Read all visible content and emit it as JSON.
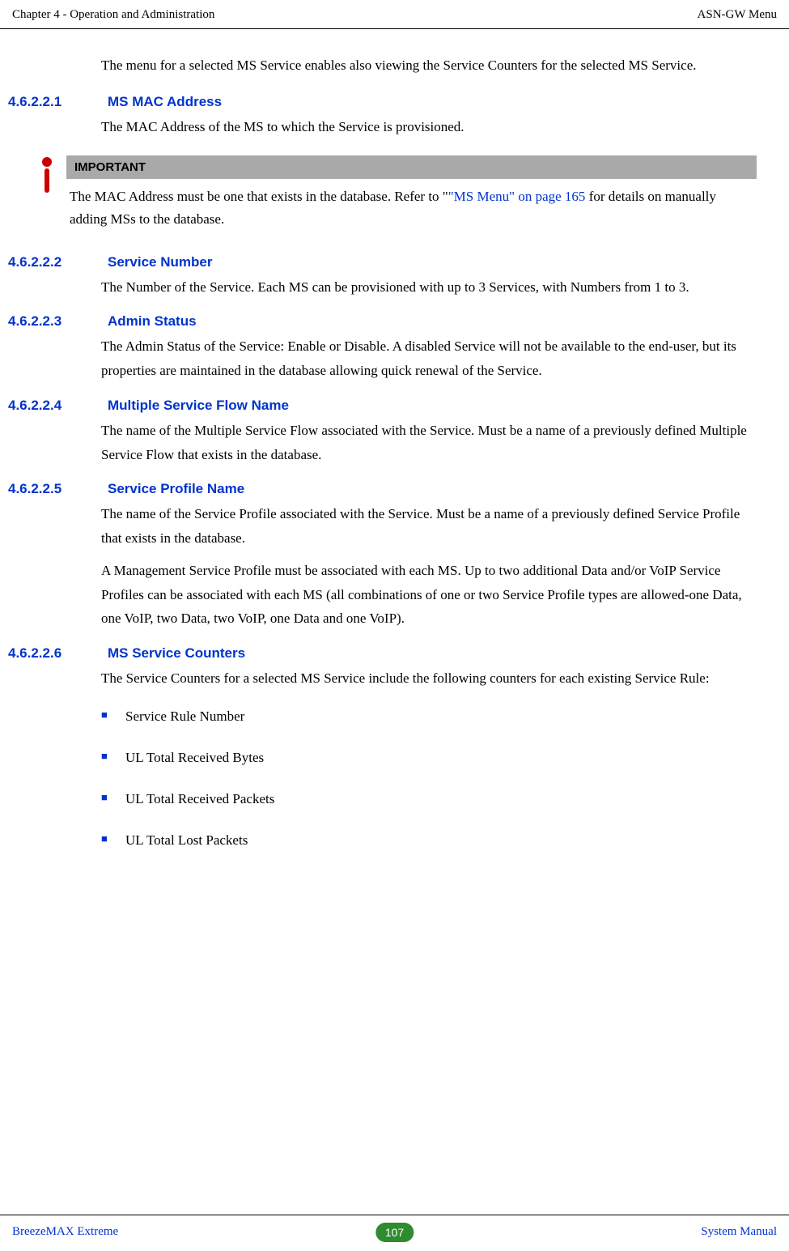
{
  "header": {
    "left": "Chapter 4 - Operation and Administration",
    "right": "ASN-GW Menu"
  },
  "intro": "The menu for a selected MS Service enables also viewing the Service Counters for the selected MS Service.",
  "sections": [
    {
      "number": "4.6.2.2.1",
      "title": "MS MAC Address",
      "body": [
        "The MAC Address of the MS to which the Service is provisioned."
      ]
    },
    {
      "number": "4.6.2.2.2",
      "title": "Service Number",
      "body": [
        "The Number of the Service. Each MS can be provisioned with up to 3 Services, with Numbers from 1 to 3."
      ]
    },
    {
      "number": "4.6.2.2.3",
      "title": "Admin Status",
      "body": [
        "The Admin Status of the Service: Enable or Disable. A disabled Service will not be available to the end-user, but its properties are maintained in the database allowing quick renewal of the Service."
      ]
    },
    {
      "number": "4.6.2.2.4",
      "title": "Multiple Service Flow Name",
      "body": [
        "The name of the Multiple Service Flow associated with the Service. Must be a name of a previously defined Multiple Service Flow that exists in the database."
      ]
    },
    {
      "number": "4.6.2.2.5",
      "title": "Service Profile Name",
      "body": [
        "The name of the Service Profile associated with the Service. Must be a name of a previously defined Service Profile that exists in the database.",
        "A Management Service Profile must be associated with each MS. Up to two additional Data and/or VoIP Service Profiles can be associated with each MS (all combinations of one or two Service Profile types are allowed-one Data, one VoIP, two Data, two VoIP, one Data and one VoIP)."
      ]
    },
    {
      "number": "4.6.2.2.6",
      "title": "MS Service Counters",
      "body": [
        "The Service Counters for a selected MS Service include the following counters for each existing Service Rule:"
      ]
    }
  ],
  "important": {
    "label": "IMPORTANT",
    "body_prefix": "The MAC Address must be one that exists in the database. Refer to \"",
    "link": "\"MS Menu\" on page 165",
    "body_suffix": " for details on manually adding MSs to the database."
  },
  "bullets": [
    "Service Rule Number",
    "UL Total Received Bytes",
    "UL Total Received Packets",
    "UL Total Lost Packets"
  ],
  "footer": {
    "left": "BreezeMAX Extreme",
    "page": "107",
    "right": "System Manual"
  }
}
